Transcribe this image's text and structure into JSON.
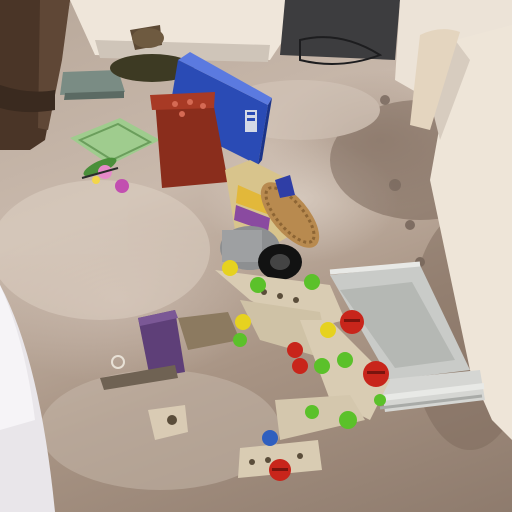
{
  "scene": {
    "background": "#b3a295"
  },
  "colors": {
    "sofa_cream": "#efe6da",
    "carpet_light": "#d8cbbf",
    "carpet_dark": "#7f6c5f",
    "box_blue": "#2a4bb5",
    "pot_terracotta": "#8a2d1c",
    "frame_beige": "#d9ccb3",
    "bolt_green": "#5bc12a",
    "bolt_yellow": "#e6d21f",
    "bolt_red": "#c8251b",
    "seat_grey": "#c9cbc8",
    "purple_block": "#5e3f78",
    "wood_brown": "#4a3527"
  },
  "icons": {
    "bolt": "green-bolt-icon",
    "gear": "gear-icon"
  }
}
